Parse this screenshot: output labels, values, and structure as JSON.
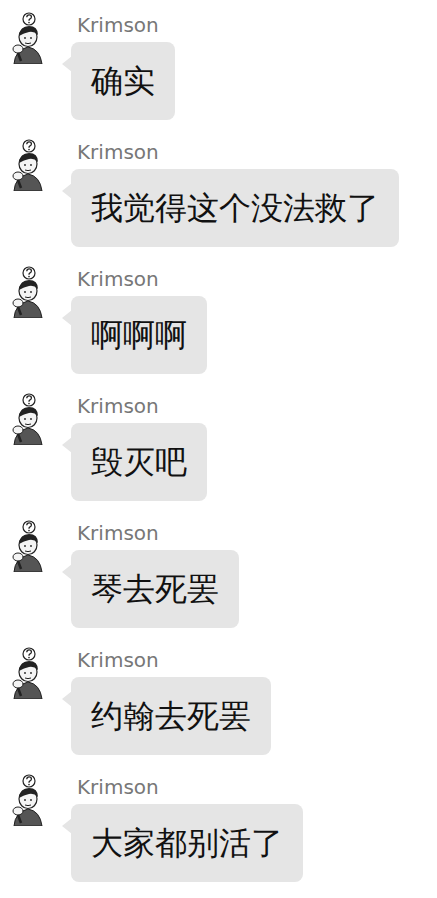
{
  "messages": [
    {
      "sender": "Krimson",
      "text": "确实"
    },
    {
      "sender": "Krimson",
      "text": "我觉得这个没法救了"
    },
    {
      "sender": "Krimson",
      "text": "啊啊啊"
    },
    {
      "sender": "Krimson",
      "text": "毁灭吧"
    },
    {
      "sender": "Krimson",
      "text": "琴去死罢"
    },
    {
      "sender": "Krimson",
      "text": "约翰去死罢"
    },
    {
      "sender": "Krimson",
      "text": "大家都别活了"
    }
  ]
}
